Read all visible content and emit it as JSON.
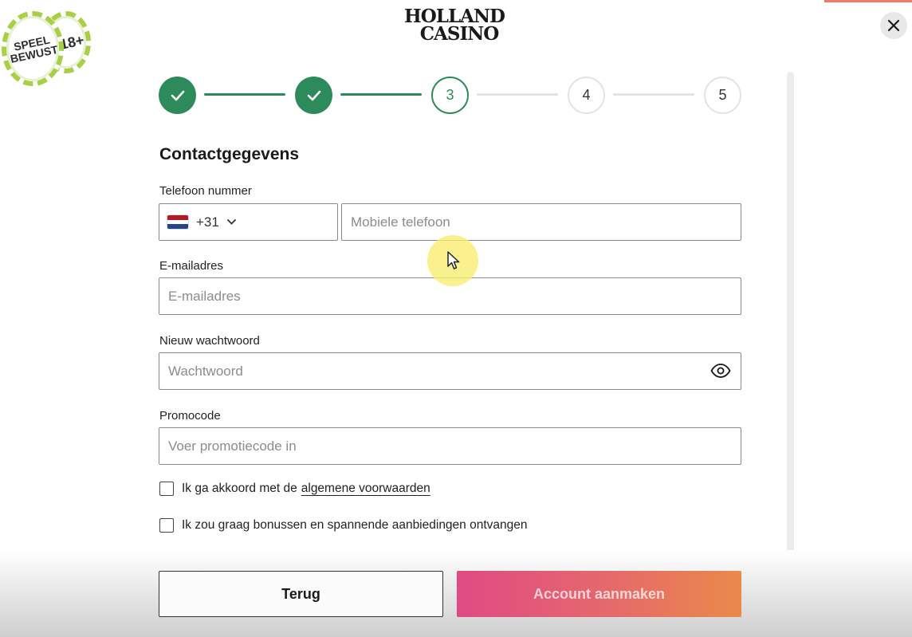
{
  "brand": {
    "logo_line1": "HOLLAND",
    "logo_line2": "CASINO",
    "badge_speel": "SPEEL\nBEWUST",
    "badge_age": "18+",
    "accent_color": "#2d8a5a",
    "cta_gradient": [
      "#e04a84",
      "#ea8a49"
    ]
  },
  "close": {
    "icon": "close-icon"
  },
  "stepper": {
    "steps": [
      {
        "label": "✓",
        "state": "done"
      },
      {
        "label": "✓",
        "state": "done"
      },
      {
        "label": "3",
        "state": "current"
      },
      {
        "label": "4",
        "state": "todo"
      },
      {
        "label": "5",
        "state": "todo"
      }
    ],
    "current_step": 3,
    "total_steps": 5
  },
  "form": {
    "title": "Contactgegevens",
    "phone": {
      "label": "Telefoon nummer",
      "country_code": "+31",
      "country_flag": "flag-nl-icon",
      "placeholder": "Mobiele telefoon"
    },
    "email": {
      "label": "E-mailadres",
      "placeholder": "E-mailadres"
    },
    "password": {
      "label": "Nieuw wachtwoord",
      "placeholder": "Wachtwoord",
      "toggle_icon": "eye-icon"
    },
    "promo": {
      "label": "Promocode",
      "placeholder": "Voer promotiecode in"
    },
    "terms": {
      "prefix": "Ik ga akkoord met de",
      "link": "algemene voorwaarden",
      "checked": false
    },
    "marketing": {
      "text": "Ik zou graag bonussen en spannende aanbiedingen ontvangen",
      "checked": false
    }
  },
  "actions": {
    "back_label": "Terug",
    "create_label": "Account aanmaken"
  }
}
